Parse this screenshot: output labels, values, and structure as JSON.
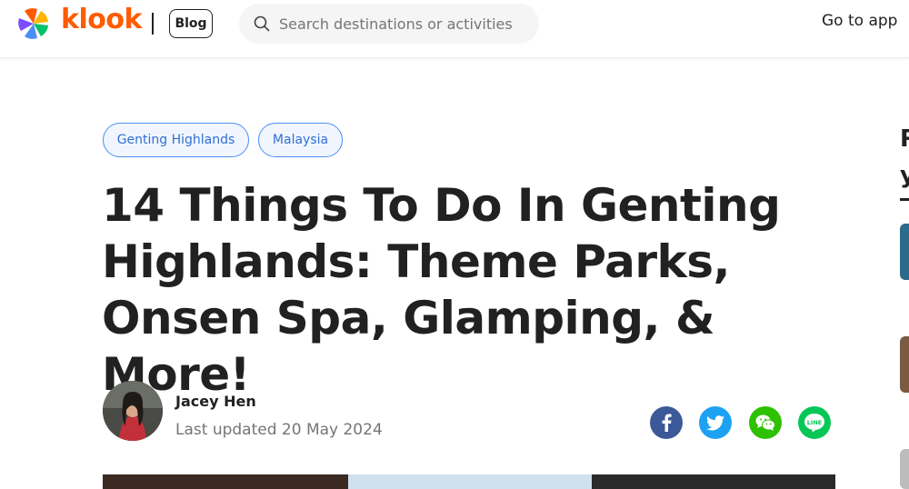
{
  "header": {
    "brand": "klook",
    "blog_label": "Blog",
    "search_placeholder": "Search destinations or activities",
    "go_to_app": "Go to app"
  },
  "tags": [
    "Genting Highlands",
    "Malaysia"
  ],
  "article": {
    "title": "14 Things To Do In Genting Highlands: Theme Parks, Onsen Spa, Glamping, & More!",
    "author": "Jacey Hen",
    "updated": "Last updated 20 May 2024"
  },
  "share": [
    "facebook-icon",
    "twitter-icon",
    "wechat-icon",
    "line-icon"
  ],
  "right_rail": {
    "heading_line1": "R",
    "heading_line2": "y"
  },
  "colors": {
    "brand_orange": "#ff5b00",
    "tag_blue": "#2f6fd6",
    "facebook": "#3b5998",
    "twitter": "#1da1f2",
    "wechat": "#2dc100",
    "line": "#06c755"
  }
}
